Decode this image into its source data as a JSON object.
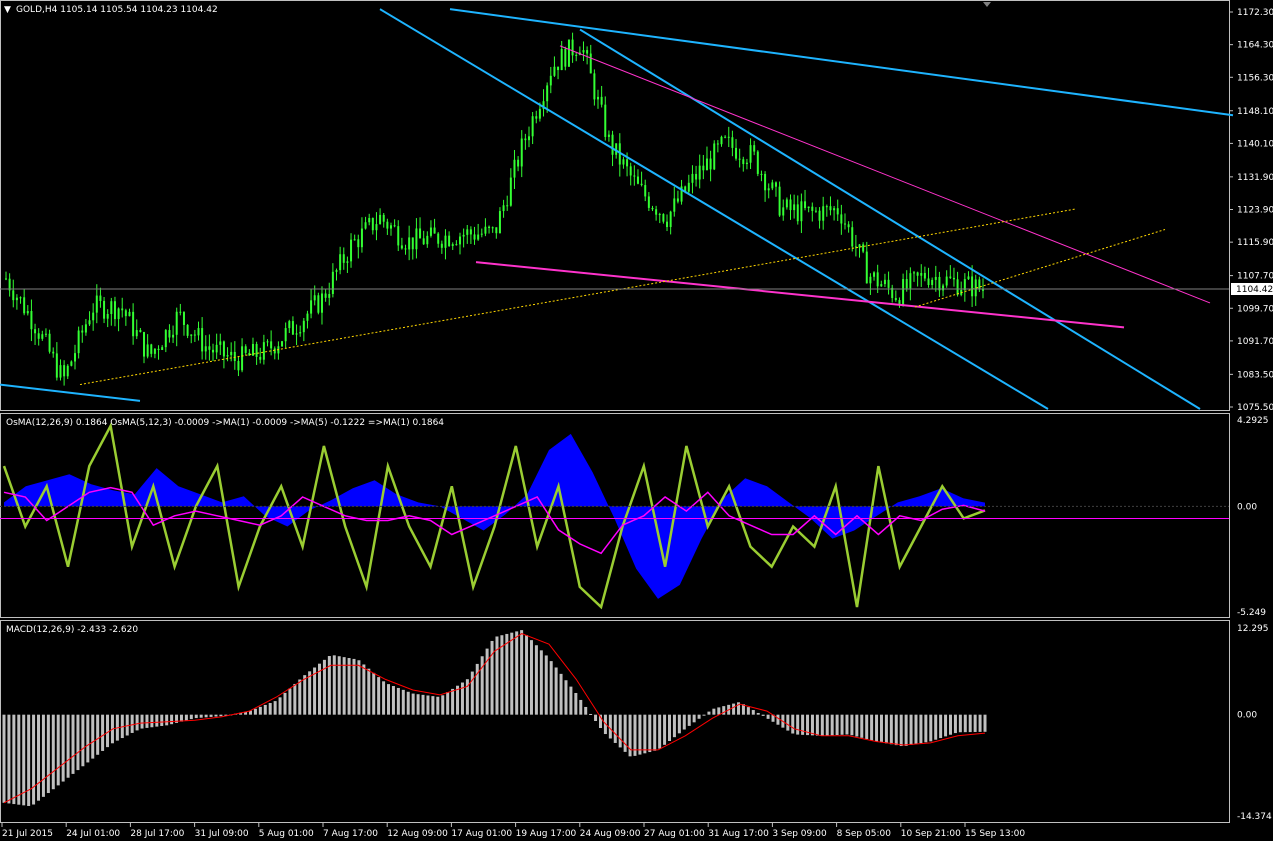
{
  "main_pane": {
    "title": "GOLD,H4  1105.14 1105.54 1104.23 1104.42",
    "current_price_label": "1104.42",
    "price_ticks": [
      "1172.30",
      "1164.30",
      "1156.30",
      "1148.10",
      "1140.10",
      "1131.90",
      "1123.90",
      "1115.90",
      "1107.70",
      "1099.70",
      "1091.70",
      "1083.50",
      "1075.50"
    ]
  },
  "osma_pane": {
    "title": "OsMA(12,26,9) 0.1864  OsMA(5,12,3) -0.0009  ->MA(1) -0.0009  ->MA(5) -0.1222  =>MA(1) 0.1864",
    "ticks": [
      "4.2925",
      "0.00",
      "-5.249"
    ]
  },
  "macd_pane": {
    "title": "MACD(12,26,9) -2.433 -2.620",
    "ticks": [
      "12.295",
      "0.00",
      "-14.374"
    ]
  },
  "time_axis": {
    "labels": [
      "21 Jul 2015",
      "24 Jul 01:00",
      "28 Jul 17:00",
      "31 Jul 09:00",
      "5 Aug 01:00",
      "7 Aug 17:00",
      "12 Aug 09:00",
      "17 Aug 01:00",
      "19 Aug 17:00",
      "24 Aug 09:00",
      "27 Aug 01:00",
      "31 Aug 17:00",
      "3 Sep 09:00",
      "8 Sep 05:00",
      "10 Sep 21:00",
      "15 Sep 13:00"
    ]
  },
  "colors": {
    "background": "#000000",
    "axis": "#c0c0c0",
    "bars": "#33ff33",
    "channel_lines": "#1eb4ff",
    "magenta_lines": "#ff33cc",
    "dotted_trend": "#ffd700",
    "osma_fill": "#0000ff",
    "osma_line": "#9acd32",
    "osma_signal": "#ff00ff",
    "macd_hist": "#c0c0c0",
    "macd_signal": "#ff0000"
  },
  "chart_data": [
    {
      "type": "candlestick",
      "symbol": "GOLD",
      "timeframe": "H4",
      "last_bar": {
        "open": 1105.14,
        "high": 1105.54,
        "low": 1104.23,
        "close": 1104.42
      },
      "ylim": [
        1075.5,
        1172.3
      ],
      "close_path": [
        {
          "x": "21 Jul 2015",
          "y": 1107
        },
        {
          "x": "23 Jul",
          "y": 1096
        },
        {
          "x": "24 Jul 01:00",
          "y": 1082
        },
        {
          "x": "27 Jul",
          "y": 1100
        },
        {
          "x": "28 Jul 17:00",
          "y": 1100
        },
        {
          "x": "30 Jul",
          "y": 1088
        },
        {
          "x": "31 Jul 09:00",
          "y": 1098
        },
        {
          "x": "3 Aug",
          "y": 1090
        },
        {
          "x": "5 Aug 01:00",
          "y": 1087
        },
        {
          "x": "6 Aug",
          "y": 1089
        },
        {
          "x": "7 Aug 17:00",
          "y": 1095
        },
        {
          "x": "10 Aug",
          "y": 1102
        },
        {
          "x": "11 Aug",
          "y": 1115
        },
        {
          "x": "12 Aug 09:00",
          "y": 1122
        },
        {
          "x": "13 Aug",
          "y": 1116
        },
        {
          "x": "14 Aug",
          "y": 1117
        },
        {
          "x": "17 Aug 01:00",
          "y": 1118
        },
        {
          "x": "18 Aug",
          "y": 1118
        },
        {
          "x": "19 Aug 17:00",
          "y": 1140
        },
        {
          "x": "21 Aug",
          "y": 1159
        },
        {
          "x": "24 Aug 09:00",
          "y": 1165
        },
        {
          "x": "25 Aug",
          "y": 1140
        },
        {
          "x": "26 Aug",
          "y": 1129
        },
        {
          "x": "27 Aug 01:00",
          "y": 1122
        },
        {
          "x": "28 Aug",
          "y": 1132
        },
        {
          "x": "31 Aug 17:00",
          "y": 1140
        },
        {
          "x": "1 Sep",
          "y": 1137
        },
        {
          "x": "3 Sep 09:00",
          "y": 1124
        },
        {
          "x": "4 Sep",
          "y": 1123
        },
        {
          "x": "8 Sep 05:00",
          "y": 1124
        },
        {
          "x": "9 Sep",
          "y": 1108
        },
        {
          "x": "10 Sep 21:00",
          "y": 1103
        },
        {
          "x": "11 Sep",
          "y": 1108
        },
        {
          "x": "14 Sep",
          "y": 1106
        },
        {
          "x": "15 Sep 13:00",
          "y": 1104.42
        }
      ]
    },
    {
      "type": "bar",
      "name": "OsMA(12,26,9)",
      "ylim": [
        -5.249,
        4.2925
      ],
      "values": [
        0.2,
        1.0,
        1.3,
        1.6,
        1.1,
        0.8,
        0.6,
        1.9,
        1.0,
        0.6,
        0.2,
        0.5,
        -0.5,
        -1.0,
        -0.2,
        0.3,
        0.9,
        1.3,
        0.6,
        0.2,
        0.0,
        -0.6,
        -1.2,
        -0.4,
        0.6,
        2.8,
        3.6,
        1.7,
        -0.6,
        -3.1,
        -4.6,
        -3.9,
        -1.6,
        0.4,
        1.4,
        1.0,
        0.2,
        -0.6,
        -1.6,
        -1.2,
        -0.5,
        0.2,
        0.5,
        0.9,
        0.4,
        0.19
      ]
    },
    {
      "type": "line",
      "name": "OsMA(5,12,3)",
      "ylim": [
        -5.249,
        4.2925
      ],
      "values": [
        2,
        -1,
        1,
        -3,
        2,
        4,
        -2,
        1,
        -3,
        0,
        2,
        -4,
        -1,
        1,
        -2,
        3,
        -1,
        -4,
        2,
        -1,
        -3,
        1,
        -4,
        -1,
        3,
        -2,
        1,
        -4,
        -5,
        -1,
        2,
        -3,
        3,
        -1,
        1,
        -2,
        -3,
        -1,
        -2,
        1,
        -5,
        2,
        -3,
        -1,
        1,
        -0.6,
        -0.2
      ]
    },
    {
      "type": "bar",
      "name": "MACD(12,26,9)",
      "ylim": [
        -14.374,
        12.295
      ],
      "values": [
        -12.5,
        -13.0,
        -10.0,
        -7.0,
        -4.0,
        -2.0,
        -1.5,
        -0.5,
        -0.2,
        0.5,
        2.0,
        5.5,
        8.5,
        7.8,
        4.5,
        3.0,
        2.5,
        5.0,
        11.0,
        12.0,
        8.0,
        3.0,
        -2.5,
        -6.0,
        -5.0,
        -2.0,
        0.8,
        1.8,
        -0.5,
        -2.8,
        -3.0,
        -2.8,
        -3.8,
        -4.5,
        -3.8,
        -2.5,
        -2.43
      ],
      "signal": [
        -12.5,
        -10.5,
        -7.5,
        -4.5,
        -2.0,
        -1.2,
        -1.0,
        -0.8,
        -0.3,
        0.5,
        2.5,
        5.0,
        7.0,
        7.0,
        5.0,
        3.5,
        2.8,
        4.0,
        9.0,
        11.5,
        10.0,
        5.0,
        -1.0,
        -5.0,
        -5.0,
        -3.0,
        -0.5,
        1.5,
        0.5,
        -2.0,
        -3.0,
        -3.0,
        -3.8,
        -4.3,
        -4.0,
        -3.0,
        -2.62
      ]
    }
  ]
}
